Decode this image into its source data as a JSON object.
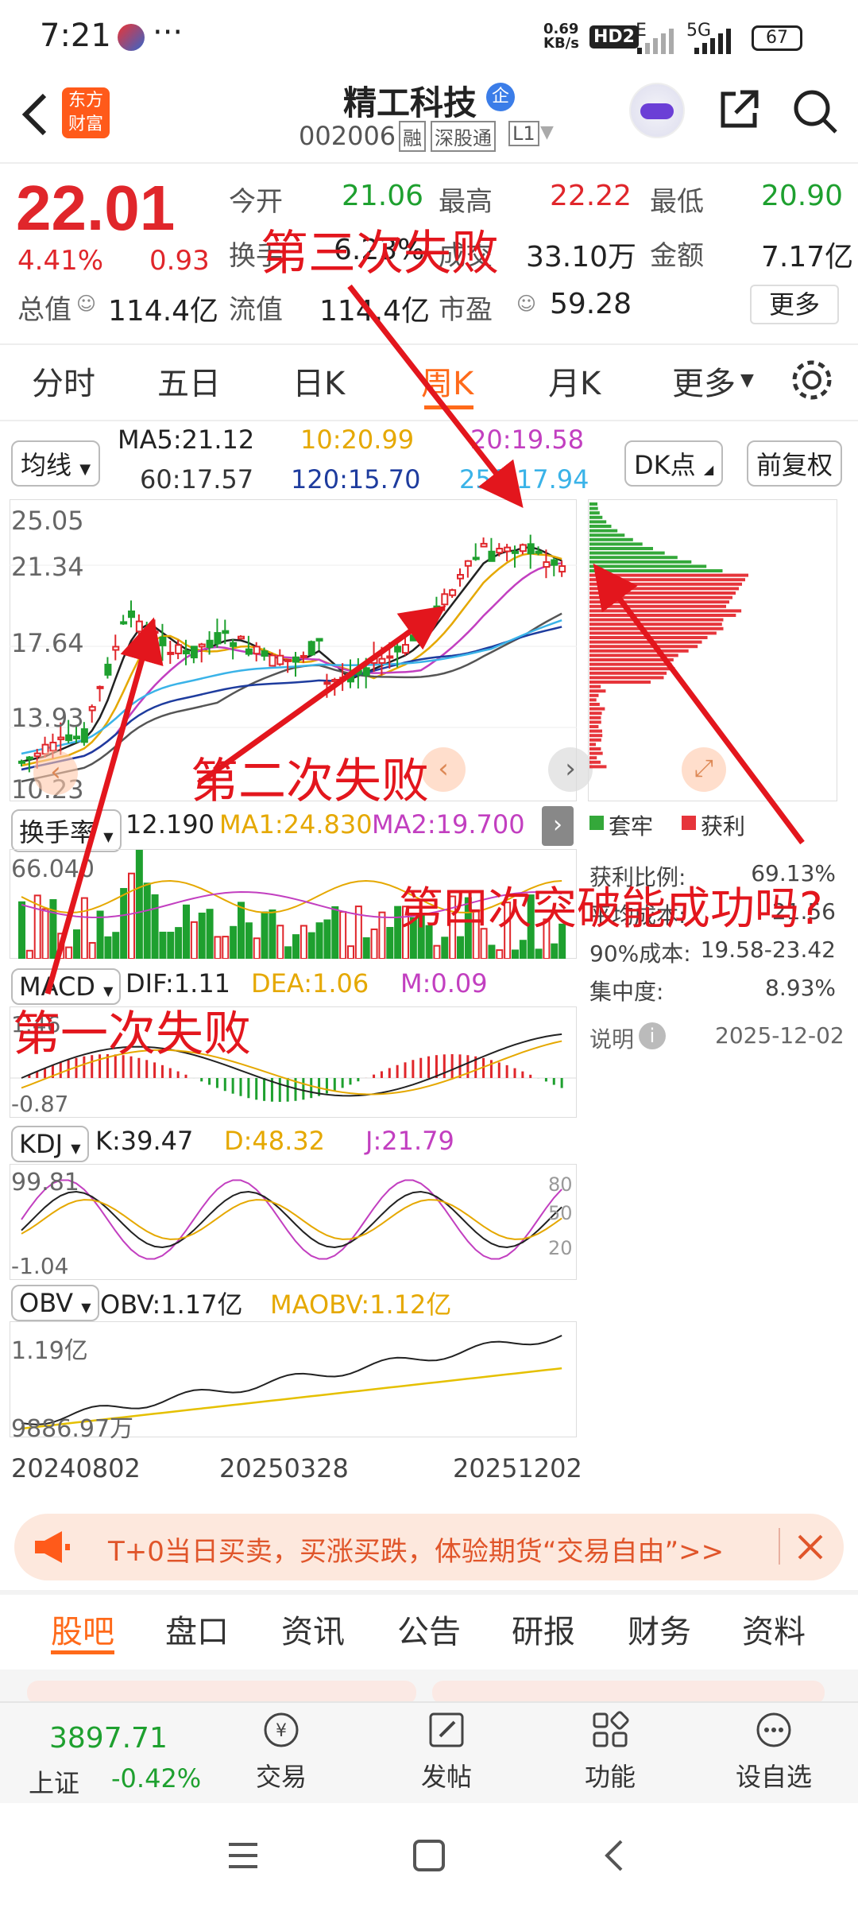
{
  "status": {
    "time": "7:21",
    "speed": "0.69\nKB/s",
    "hd": "HD2",
    "net1": "E",
    "net2": "5G",
    "battery": "67"
  },
  "header": {
    "back": "back",
    "logo_line1": "东方",
    "logo_line2": "财富",
    "title": "精工科技",
    "title_badge": "企",
    "code": "002006",
    "tags": [
      "融",
      "深股通",
      "L1"
    ]
  },
  "quote": {
    "price": "22.01",
    "pct": "4.41%",
    "chg": "0.93",
    "r1": [
      {
        "k": "今开",
        "v": "21.06"
      },
      {
        "k": "最高",
        "v": "22.22"
      },
      {
        "k": "最低",
        "v": "20.90"
      }
    ],
    "r2": [
      {
        "k": "换手",
        "v": "6.23%"
      },
      {
        "k": "成交",
        "v": "33.10万"
      },
      {
        "k": "金额",
        "v": "7.17亿"
      }
    ],
    "r3": [
      {
        "k": "总值",
        "v": "114.4亿"
      },
      {
        "k": "流值",
        "v": "114.4亿"
      },
      {
        "k": "市盈",
        "v": "59.28"
      }
    ],
    "more": "更多"
  },
  "tabs": [
    "分时",
    "五日",
    "日K",
    "周K",
    "月K",
    "更多"
  ],
  "ma": {
    "type": "均线",
    "ma5": "MA5:21.12",
    "ma10": "10:20.99",
    "ma20": "20:19.58",
    "ma60": "60:17.57",
    "ma120": "120:15.70",
    "ma250": "250:17.94",
    "dk": "DK点",
    "fq": "前复权"
  },
  "price_axis": [
    "25.05",
    "21.34",
    "17.64",
    "13.93",
    "10.23"
  ],
  "turnover": {
    "label": "换手率",
    "v": "12.190",
    "ma1": "MA1:24.830",
    "ma2": "MA2:19.700",
    "axis": "66.040"
  },
  "macd": {
    "label": "MACD",
    "dif": "DIF:1.11",
    "dea": "DEA:1.06",
    "m": "M:0.09",
    "axis_top": "1.46",
    "axis_bot": "-0.87"
  },
  "kdj": {
    "label": "KDJ",
    "k": "K:39.47",
    "d": "D:48.32",
    "j": "J:21.79",
    "axis_top": "99.81",
    "axis_bot": "-1.04",
    "r80": "80",
    "r50": "50",
    "r20": "20"
  },
  "obv": {
    "label": "OBV",
    "obv": "OBV:1.17亿",
    "maobv": "MAOBV:1.12亿",
    "axis_top": "1.19亿",
    "axis_bot": "9886.97万"
  },
  "dates": [
    "20240802",
    "20250328",
    "20251202"
  ],
  "chip": {
    "trapped": "套牢",
    "profit": "获利",
    "rows": [
      {
        "k": "获利比例:",
        "v": "69.13%"
      },
      {
        "k": "平均成本:",
        "v": "21.56"
      },
      {
        "k": "90%成本:",
        "v": "19.58-23.42"
      },
      {
        "k": "集中度:",
        "v": "8.93%"
      }
    ],
    "note": "说明",
    "date": "2025-12-02"
  },
  "banner": {
    "text": "T+0当日买卖，买涨买跌，体验期货“交易自由”>>"
  },
  "bottom_tabs": [
    "股吧",
    "盘口",
    "资讯",
    "公告",
    "研报",
    "财务",
    "资料"
  ],
  "index": {
    "value": "3897.71",
    "name": "上证",
    "pct": "-0.42%"
  },
  "nav": [
    "交易",
    "发帖",
    "功能",
    "设自选"
  ],
  "annotations": [
    "第三次失败",
    "第二次失败",
    "第四次突破能成功吗?",
    "第一次失败"
  ],
  "colors": {
    "up": "#e0262b",
    "down": "#1ea02f",
    "accent": "#ff6a1a"
  }
}
